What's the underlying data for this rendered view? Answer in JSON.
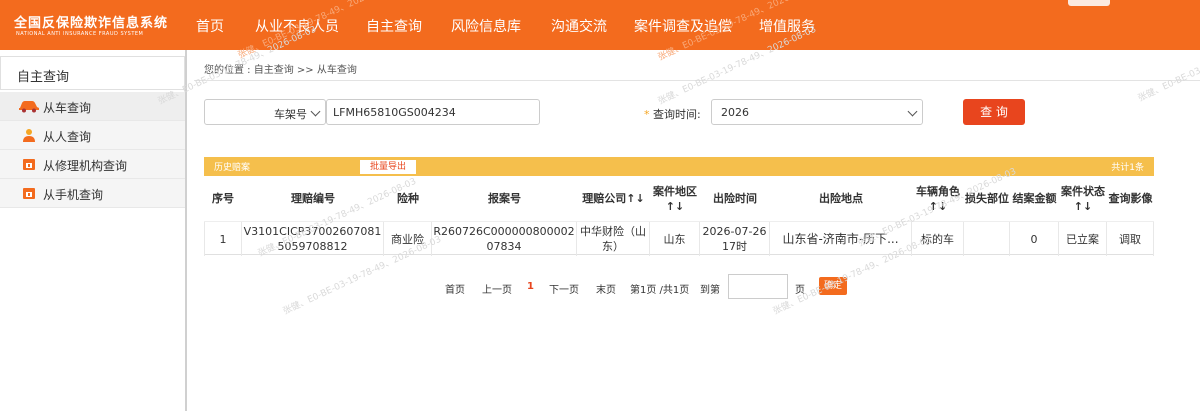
{
  "app": {
    "logo_title": "全国反保险欺诈信息系统",
    "logo_subtitle": "NATIONAL ANTI INSURANCE FRAUD SYSTEM"
  },
  "nav": [
    {
      "label": "首页"
    },
    {
      "label": "从业不良人员"
    },
    {
      "label": "自主查询"
    },
    {
      "label": "风险信息库"
    },
    {
      "label": "沟通交流"
    },
    {
      "label": "案件调查及追偿"
    },
    {
      "label": "增值服务"
    }
  ],
  "sidebar": {
    "title": "自主查询",
    "items": [
      {
        "label": "从车查询",
        "icon": "car-icon"
      },
      {
        "label": "从人查询",
        "icon": "person-icon"
      },
      {
        "label": "从修理机构查询",
        "icon": "repair-shop-icon"
      },
      {
        "label": "从手机查询",
        "icon": "phone-icon"
      }
    ]
  },
  "breadcrumb": "您的位置 : 自主查询 >> 从车查询",
  "search": {
    "type_selected": "车架号",
    "vin_value": "LFMH65810GS004234",
    "time_label_star": "*",
    "time_label": "查询时间:",
    "time_selected": "2026",
    "query_button": "查 询"
  },
  "results": {
    "bar_label": "历史赔案",
    "export_button": "批量导出",
    "total": "共计1条",
    "headers": [
      "序号",
      "理赔编号",
      "险种",
      "报案号",
      "理赔公司↑↓",
      "案件地区↑↓",
      "出险时间",
      "出险地点",
      "车辆角色↑↓",
      "损失部位",
      "结案金额",
      "案件状态↑↓",
      "查询影像"
    ],
    "rows": [
      [
        "1",
        "V3101CICP370026070815059708812",
        "商业险",
        "R260726C00000080000207834",
        "中华财险（山东）",
        "山东",
        "2026-07-26 17时",
        "山东省-济南市-历下...",
        "标的车",
        "",
        "0",
        "已立案",
        "调取"
      ]
    ]
  },
  "pager": {
    "first": "首页",
    "prev": "上一页",
    "current": "1",
    "next": "下一页",
    "last": "末页",
    "info": "第1页 /共1页",
    "goto_label": "到第",
    "page_unit": "页",
    "confirm": "确定"
  },
  "watermark": "张健、E0-BE-03-19-78-49、2026-08-03",
  "colors": {
    "nav_bg": "#f36b1e",
    "query_button": "#e8451e",
    "result_bar": "#f5bf4c"
  }
}
